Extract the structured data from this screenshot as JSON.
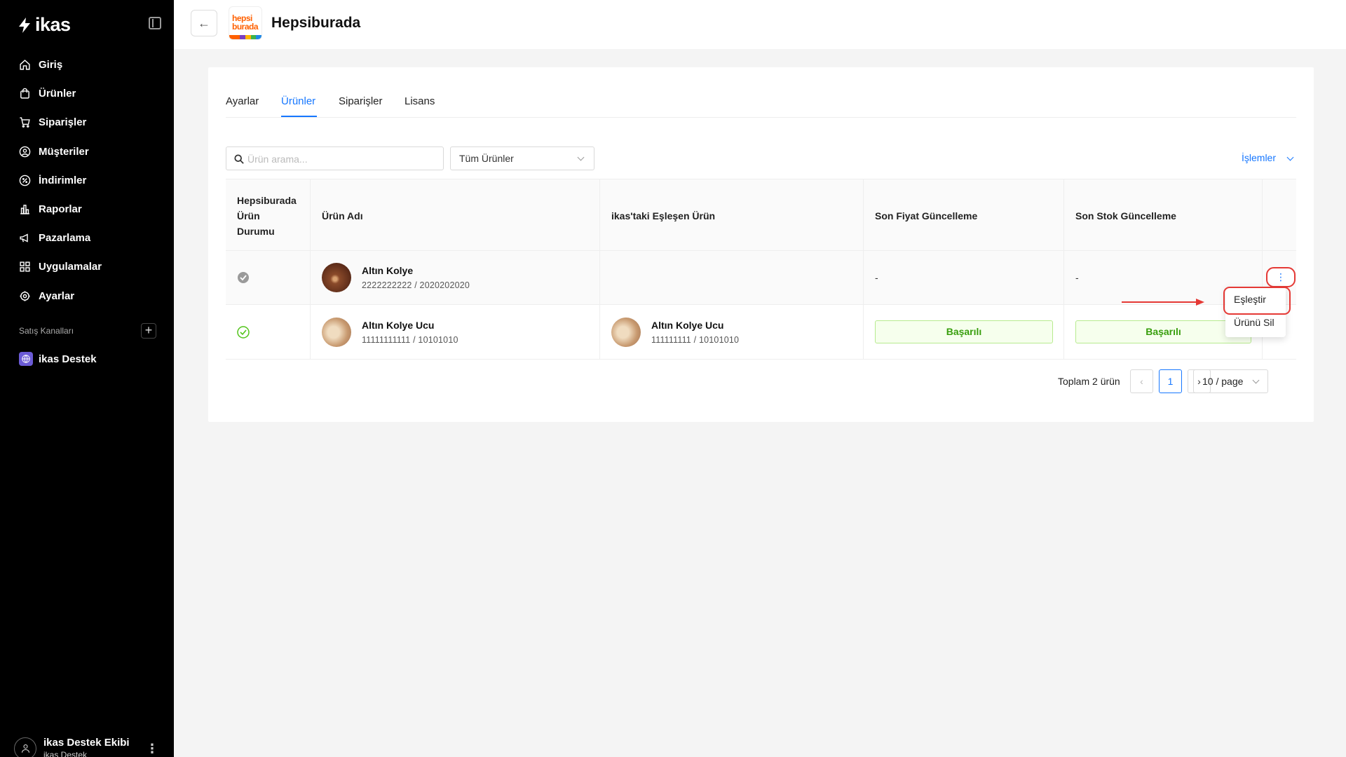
{
  "sidebar": {
    "logo": "ikas",
    "nav": [
      {
        "label": "Giriş",
        "icon": "home-icon"
      },
      {
        "label": "Ürünler",
        "icon": "bag-icon"
      },
      {
        "label": "Siparişler",
        "icon": "cart-icon"
      },
      {
        "label": "Müşteriler",
        "icon": "user-circle-icon"
      },
      {
        "label": "İndirimler",
        "icon": "discount-icon"
      },
      {
        "label": "Raporlar",
        "icon": "chart-icon"
      },
      {
        "label": "Pazarlama",
        "icon": "megaphone-icon"
      },
      {
        "label": "Uygulamalar",
        "icon": "grid-icon"
      },
      {
        "label": "Ayarlar",
        "icon": "gear-icon"
      }
    ],
    "channels_label": "Satış Kanalları",
    "channel": "ikas Destek",
    "user": {
      "name": "ikas Destek Ekibi",
      "sub": "ikas Destek"
    }
  },
  "header": {
    "title": "Hepsiburada",
    "brand_logo_text_1": "hepsi",
    "brand_logo_text_2": "burada",
    "brand_colors": [
      "#ff6000",
      "#ff6000",
      "#7b3fbf",
      "#ffb400",
      "#3cb34a",
      "#1e88e5"
    ]
  },
  "tabs": [
    "Ayarlar",
    "Ürünler",
    "Siparişler",
    "Lisans"
  ],
  "active_tab": "Ürünler",
  "toolbar": {
    "search_placeholder": "Ürün arama...",
    "filter_value": "Tüm Ürünler",
    "actions_label": "İşlemler"
  },
  "table": {
    "columns": [
      "Hepsiburada Ürün Durumu",
      "Ürün Adı",
      "ikas'taki Eşleşen Ürün",
      "Son Fiyat Güncelleme",
      "Son Stok Güncelleme"
    ],
    "rows": [
      {
        "status": "unmatched",
        "product_name": "Altın Kolye",
        "product_code": "2222222222 / 2020202020",
        "matched_name": "",
        "matched_code": "",
        "price_update": "-",
        "stock_update": "-"
      },
      {
        "status": "matched",
        "product_name": "Altın Kolye Ucu",
        "product_code": "11111111111 / 10101010",
        "matched_name": "Altın Kolye Ucu",
        "matched_code": "111111111 / 10101010",
        "price_update": "Başarılı",
        "stock_update": "Başarılı"
      }
    ]
  },
  "row_menu": {
    "items": [
      "Eşleştir",
      "Ürünü Sil"
    ]
  },
  "pagination": {
    "total": "Toplam 2 ürün",
    "current_page": "1",
    "page_size": "10 / page"
  },
  "colors": {
    "accent": "#1677ff",
    "success": "#52c41a",
    "highlight": "#e53935"
  }
}
